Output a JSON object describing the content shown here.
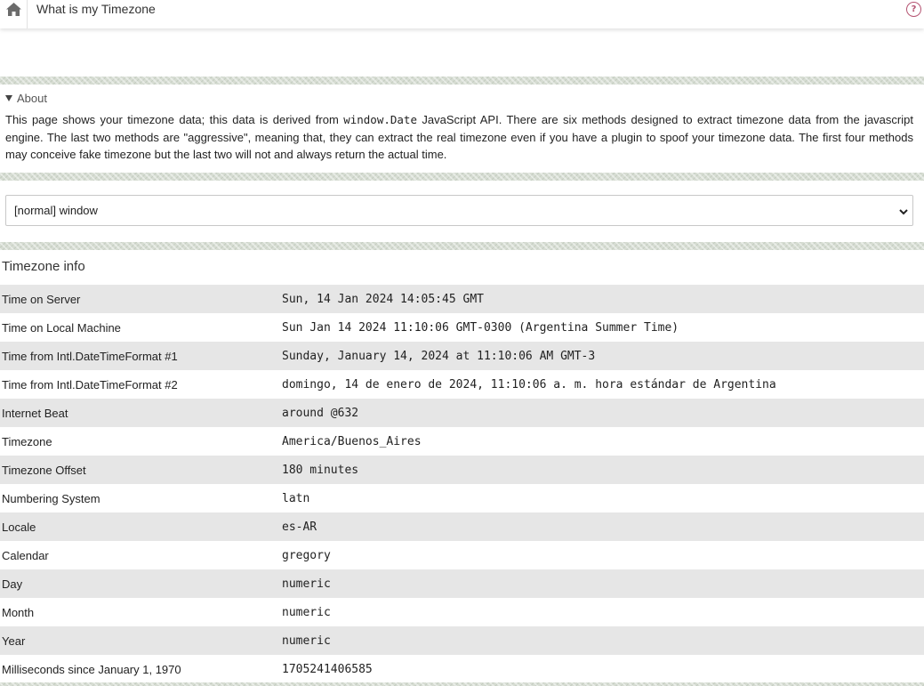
{
  "header": {
    "title": "What is my Timezone",
    "home_icon": "home-icon",
    "help_label": "?"
  },
  "about": {
    "summary": "About",
    "text_before": "This page shows your timezone data; this data is derived from ",
    "code": "window.Date",
    "text_after": " JavaScript API. There are six methods designed to extract timezone data from the javascript engine. The last two methods are \"aggressive\", meaning that, they can extract the real timezone even if you have a plugin to spoof your timezone data. The first four methods may conceive fake timezone but the last two will not and always return the actual time."
  },
  "method_select": {
    "selected": "[normal] window"
  },
  "timezone_info": {
    "title": "Timezone info",
    "rows": [
      {
        "label": "Time on Server",
        "value": "Sun, 14 Jan 2024 14:05:45 GMT"
      },
      {
        "label": "Time on Local Machine",
        "value": "Sun Jan 14 2024 11:10:06 GMT-0300 (Argentina Summer Time)"
      },
      {
        "label": "Time from Intl.DateTimeFormat #1",
        "value": "Sunday, January 14, 2024 at 11:10:06 AM GMT-3"
      },
      {
        "label": "Time from Intl.DateTimeFormat #2",
        "value": "domingo, 14 de enero de 2024, 11:10:06 a. m. hora estándar de Argentina"
      },
      {
        "label": "Internet Beat",
        "value": "around @632"
      },
      {
        "label": "Timezone",
        "value": "America/Buenos_Aires"
      },
      {
        "label": "Timezone Offset",
        "value": "180 minutes"
      },
      {
        "label": "Numbering System",
        "value": "latn"
      },
      {
        "label": "Locale",
        "value": "es-AR"
      },
      {
        "label": "Calendar",
        "value": "gregory"
      },
      {
        "label": "Day",
        "value": "numeric"
      },
      {
        "label": "Month",
        "value": "numeric"
      },
      {
        "label": "Year",
        "value": "numeric"
      },
      {
        "label": "Milliseconds since January 1, 1970",
        "value": "1705241406585"
      }
    ]
  }
}
